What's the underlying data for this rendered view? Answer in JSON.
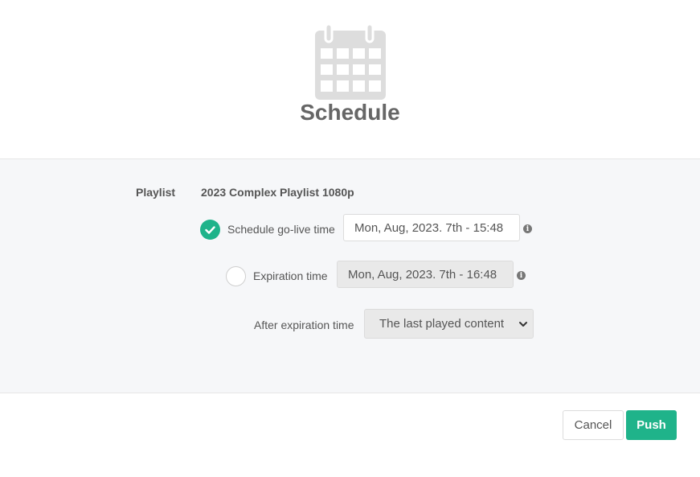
{
  "header": {
    "icon": "calendar-icon",
    "title": "Schedule"
  },
  "form": {
    "playlist_label": "Playlist",
    "playlist_name": "2023 Complex Playlist 1080p",
    "go_live": {
      "checked": true,
      "label": "Schedule go-live time",
      "value": "Mon, Aug, 2023. 7th - 15:48"
    },
    "expiration": {
      "checked": false,
      "label": "Expiration time",
      "value": "Mon, Aug, 2023. 7th - 16:48"
    },
    "after_expiration": {
      "label": "After expiration time",
      "selected": "The last played content"
    }
  },
  "footer": {
    "cancel_label": "Cancel",
    "push_label": "Push"
  },
  "colors": {
    "accent": "#1fb38a",
    "icon_gray": "#dddddd",
    "panel_bg": "#f6f7f9"
  }
}
